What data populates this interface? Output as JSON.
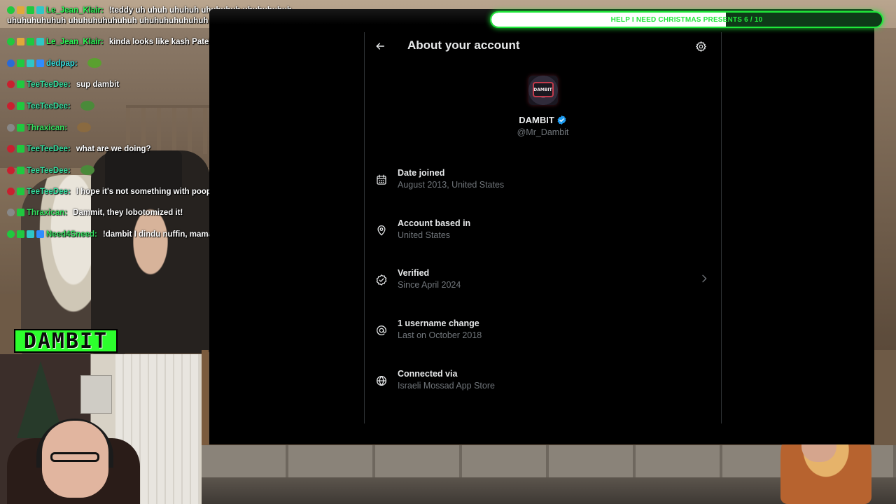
{
  "goal_bar": {
    "text": "HELP I NEED CHRISTMAS PRESENTS 6 / 10",
    "progress": 0.6,
    "fill_color": "#ffffff",
    "border_color": "#1fe83a"
  },
  "chat": {
    "messages": [
      {
        "user": "Le_Jean_Klair:",
        "user_color": "#2cff5a",
        "text": "!teddy uh uhuh uhuhuh uhuhuhuh uhuhuhuhuh uhuhuhuhuhuh uhuhuhuhuhuhuh uhuhuhuhuhuhuh",
        "badges": [
          "#20c83f",
          "#e0a83a",
          "#20c83f",
          "#2fc6c6"
        ],
        "emote": ""
      },
      {
        "user": "Le_Jean_Klair:",
        "user_color": "#2cff5a",
        "text": "kinda looks like kash Patel",
        "badges": [
          "#20c83f",
          "#e0a83a",
          "#20c83f",
          "#2fc6c6"
        ],
        "emote": ""
      },
      {
        "user": "dedpap:",
        "user_color": "#36e0e0",
        "text": "",
        "badges": [
          "#2a6ad6",
          "#20c83f",
          "#2fc6c6",
          "#2f8cff"
        ],
        "emote": "#5aa030"
      },
      {
        "user": "TeeTeeDee:",
        "user_color": "#36e0a0",
        "text": "sup dambit",
        "badges": [
          "#c8202f",
          "#20c83f"
        ],
        "emote": ""
      },
      {
        "user": "TeeTeeDee:",
        "user_color": "#36e0a0",
        "text": "",
        "badges": [
          "#c8202f",
          "#20c83f"
        ],
        "emote": "#4a8a3a"
      },
      {
        "user": "Thraxican:",
        "user_color": "#36e060",
        "text": "",
        "badges": [
          "#888888",
          "#20c83f"
        ],
        "emote": "#8a6a40"
      },
      {
        "user": "TeeTeeDee:",
        "user_color": "#36e0a0",
        "text": "what are we doing?",
        "badges": [
          "#c8202f",
          "#20c83f"
        ],
        "emote": ""
      },
      {
        "user": "TeeTeeDee:",
        "user_color": "#36e0a0",
        "text": "",
        "badges": [
          "#c8202f",
          "#20c83f"
        ],
        "emote": "#4a8a3a"
      },
      {
        "user": "TeeTeeDee:",
        "user_color": "#36e0a0",
        "text": "I hope it's not something with poop again",
        "badges": [
          "#c8202f",
          "#20c83f"
        ],
        "emote": ""
      },
      {
        "user": "Thraxican:",
        "user_color": "#36e060",
        "text": "Dammit, they lobotomized it!",
        "badges": [
          "#888888",
          "#20c83f"
        ],
        "emote": ""
      },
      {
        "user": "Need4Sneed:",
        "user_color": "#36e060",
        "text": "!dambit I dindu nuffin, mama save me from blacks",
        "badges": [
          "#20c83f",
          "#20c83f",
          "#2fc6c6",
          "#2f8cff"
        ],
        "emote": "#6a9a30"
      }
    ]
  },
  "streamer_logo": "DAMBIT",
  "panel": {
    "title": "About your account",
    "back_icon": "arrow-left-icon",
    "settings_icon": "gear-icon",
    "avatar_text": "DAMBIT",
    "display_name": "DAMBIT",
    "handle": "@Mr_Dambit",
    "verified_color": "#1d9bf0",
    "items": [
      {
        "icon": "calendar-icon",
        "title": "Date joined",
        "subtitle": "August 2013, United States",
        "chevron": false
      },
      {
        "icon": "location-pin-icon",
        "title": "Account based in",
        "subtitle": "United States",
        "chevron": false
      },
      {
        "icon": "verified-check-icon",
        "title": "Verified",
        "subtitle": "Since April 2024",
        "chevron": true
      },
      {
        "icon": "at-sign-icon",
        "title": "1 username change",
        "subtitle": "Last on October 2018",
        "chevron": false
      },
      {
        "icon": "globe-icon",
        "title": "Connected via",
        "subtitle": "Israeli Mossad App Store",
        "chevron": false
      }
    ]
  }
}
